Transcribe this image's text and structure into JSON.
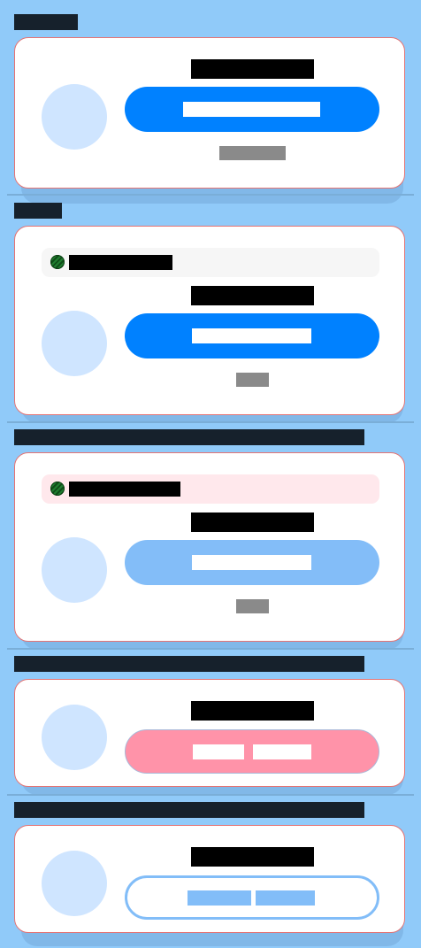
{
  "colors": {
    "background": "#90caf9",
    "card": "#ffffff",
    "card_border": "#e57373",
    "avatar": "#cfe5ff",
    "primary": "#0081ff",
    "primary_disabled": "#83bdf8",
    "danger": "#ff93a9",
    "outline": "#82bdf8",
    "notice_neutral": "#f6f6f6",
    "notice_error": "#ffe8ec"
  },
  "sections": [
    {
      "label": "",
      "title": "",
      "button_label": "",
      "caption": ""
    },
    {
      "label": "",
      "notice": {
        "icon": "status-icon",
        "text": ""
      },
      "title": "",
      "button_label": "",
      "caption": ""
    },
    {
      "label": "",
      "notice": {
        "icon": "status-icon",
        "text": ""
      },
      "title": "",
      "button_label": "",
      "caption": ""
    },
    {
      "label": "",
      "title": "",
      "button_label_1": "",
      "button_label_2": ""
    },
    {
      "label": "",
      "title": "",
      "button_label_1": "",
      "button_label_2": ""
    }
  ]
}
